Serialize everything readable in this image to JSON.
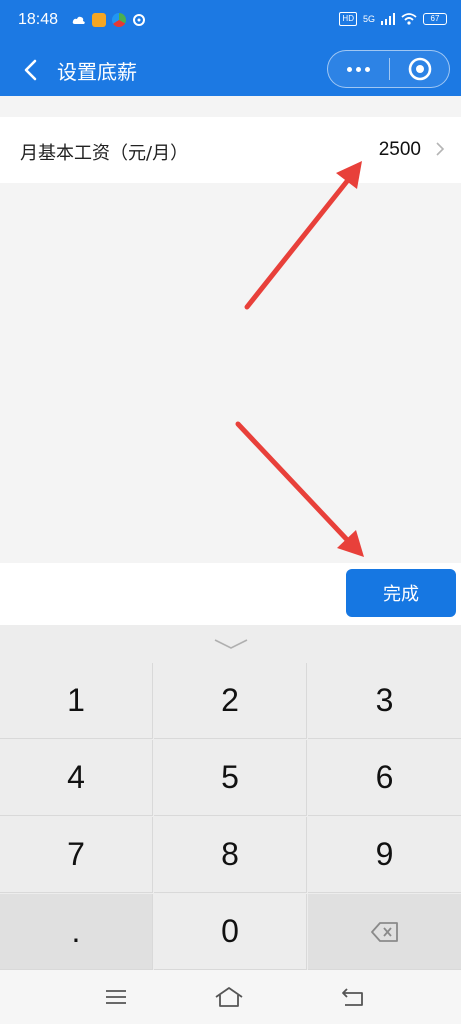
{
  "status_bar": {
    "time": "18:48",
    "hd": "HD",
    "network": "5G",
    "battery": "67"
  },
  "header": {
    "title": "设置底薪",
    "back_icon": "chevron-left-icon",
    "more_icon": "more-dots-icon",
    "close_icon": "target-circle-icon"
  },
  "form": {
    "salary_label": "月基本工资（元/月）",
    "salary_value": "2500"
  },
  "toolbar": {
    "done_label": "完成"
  },
  "keyboard": {
    "keys": [
      "1",
      "2",
      "3",
      "4",
      "5",
      "6",
      "7",
      "8",
      "9",
      ".",
      "0"
    ],
    "backspace_icon": "backspace-icon",
    "collapse_icon": "chevron-down-icon"
  },
  "colors": {
    "brand_blue": "#1c79e3",
    "button_blue": "#1677e2",
    "annotation_red": "#e8403a"
  }
}
